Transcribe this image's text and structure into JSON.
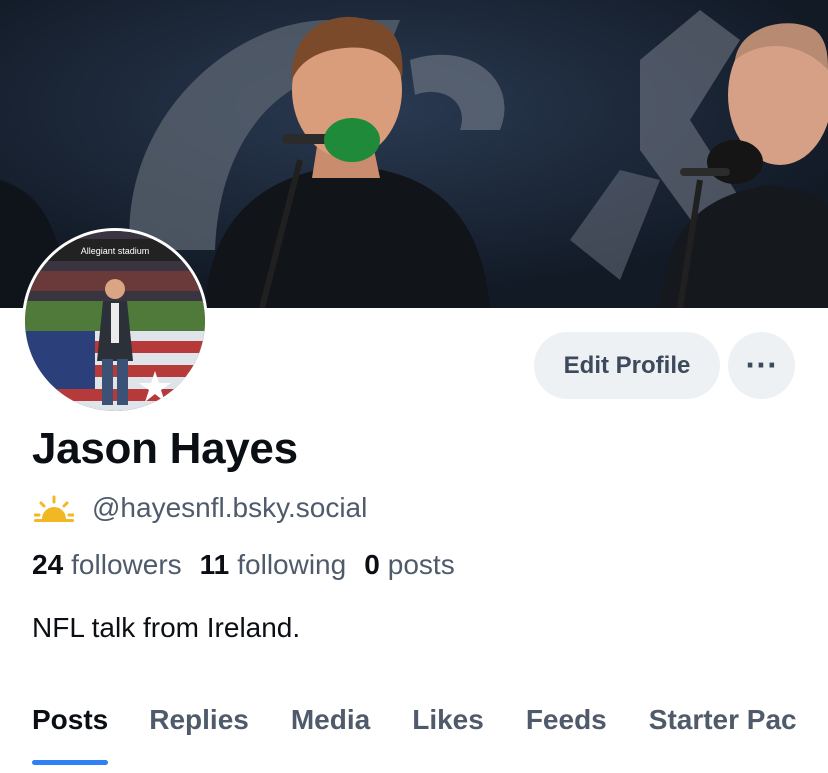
{
  "profile": {
    "name": "Jason Hayes",
    "handle": "@hayesnfl.bsky.social",
    "bio": "NFL talk from Ireland.",
    "avatar_sign": "Allegiant stadium"
  },
  "stats": {
    "followers": {
      "count": "24",
      "label": "followers"
    },
    "following": {
      "count": "11",
      "label": "following"
    },
    "posts": {
      "count": "0",
      "label": "posts"
    }
  },
  "actions": {
    "edit_label": "Edit Profile",
    "more_label": "···"
  },
  "tabs": [
    {
      "label": "Posts",
      "active": true
    },
    {
      "label": "Replies",
      "active": false
    },
    {
      "label": "Media",
      "active": false
    },
    {
      "label": "Likes",
      "active": false
    },
    {
      "label": "Feeds",
      "active": false
    },
    {
      "label": "Starter Pac",
      "active": false
    }
  ],
  "colors": {
    "accent": "#2f80f2",
    "button_bg": "#eef1f4",
    "muted_text": "#4f5b6b",
    "sun_icon": "#f2b824"
  },
  "icons": {
    "status": "sun-icon",
    "more": "ellipsis-icon"
  }
}
